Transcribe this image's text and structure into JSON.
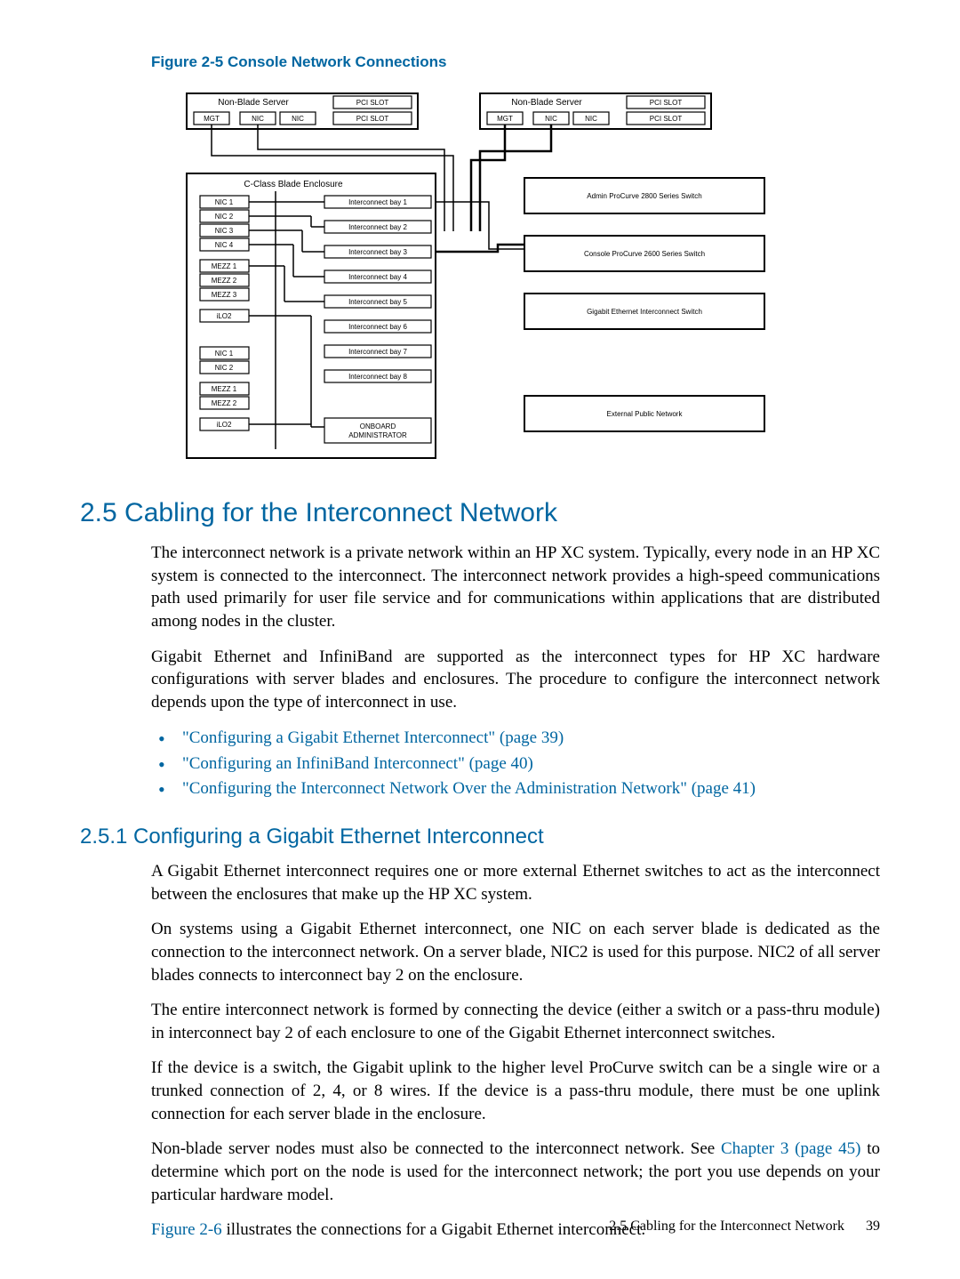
{
  "figure_caption": "Figure 2-5 Console Network Connections",
  "diagram": {
    "servers": {
      "title": "Non-Blade Server",
      "pcislot": "PCI SLOT",
      "mgt": "MGT",
      "nic": "NIC"
    },
    "enclosure": {
      "title": "C-Class Blade Enclosure",
      "left": [
        "NIC 1",
        "NIC 2",
        "NIC 3",
        "NIC 4",
        "MEZZ 1",
        "MEZZ 2",
        "MEZZ 3",
        "iLO2",
        "NIC 1",
        "NIC 2",
        "MEZZ 1",
        "MEZZ 2",
        "iLO2"
      ],
      "right": [
        "Interconnect bay 1",
        "Interconnect bay 2",
        "Interconnect bay 3",
        "Interconnect bay 4",
        "Interconnect bay 5",
        "Interconnect bay 6",
        "Interconnect bay 7",
        "Interconnect bay 8",
        "ONBOARD ADMINISTRATOR"
      ]
    },
    "right_boxes": [
      "Admin ProCurve 2800 Series Switch",
      "Console ProCurve 2600 Series Switch",
      "Gigabit Ethernet Interconnect Switch",
      "External Public Network"
    ]
  },
  "section_25_title": "2.5 Cabling for the Interconnect Network",
  "p1": "The interconnect network is a private network within an HP XC system. Typically, every node in an HP XC system is connected to the interconnect. The interconnect network provides a high-speed communications path used primarily for user file service and for communications within applications that are distributed among nodes in the cluster.",
  "p2": "Gigabit Ethernet and InfiniBand are supported as the interconnect types for HP XC hardware configurations with server blades and enclosures. The procedure to configure the interconnect network depends upon the type of interconnect in use.",
  "bullets": [
    "\"Configuring a Gigabit Ethernet Interconnect\" (page 39)",
    "\"Configuring an InfiniBand Interconnect\" (page 40)",
    "\"Configuring the Interconnect Network Over the Administration Network\" (page 41)"
  ],
  "section_251_title": "2.5.1 Configuring a Gigabit Ethernet Interconnect",
  "p3": "A Gigabit Ethernet interconnect requires one or more external Ethernet switches to act as the interconnect between the enclosures that make up the HP XC system.",
  "p4": "On systems using a Gigabit Ethernet interconnect, one NIC on each server blade is dedicated as the connection to the interconnect network. On a server blade, NIC2 is used for this purpose. NIC2 of all server blades connects to interconnect bay 2 on the enclosure.",
  "p5": "The entire interconnect network is formed by connecting the device (either a switch or a pass-thru module) in interconnect bay 2 of each enclosure to one of the Gigabit Ethernet interconnect switches.",
  "p6": "If the device is a switch, the Gigabit uplink to the higher level ProCurve switch can be a single wire or a trunked connection of 2, 4, or 8 wires. If the device is a pass-thru module, there must be one uplink connection for each server blade in the enclosure.",
  "p7a": "Non-blade server nodes must also be connected to the interconnect network. See ",
  "p7_link": "Chapter 3 (page 45)",
  "p7b": " to determine which port on the node is used for the interconnect network; the port you use depends on your particular hardware model.",
  "p8a": "",
  "p8_link": "Figure 2-6",
  "p8b": " illustrates the connections for a Gigabit Ethernet interconnect.",
  "footer_text": "2.5 Cabling for the Interconnect Network",
  "footer_page": "39"
}
